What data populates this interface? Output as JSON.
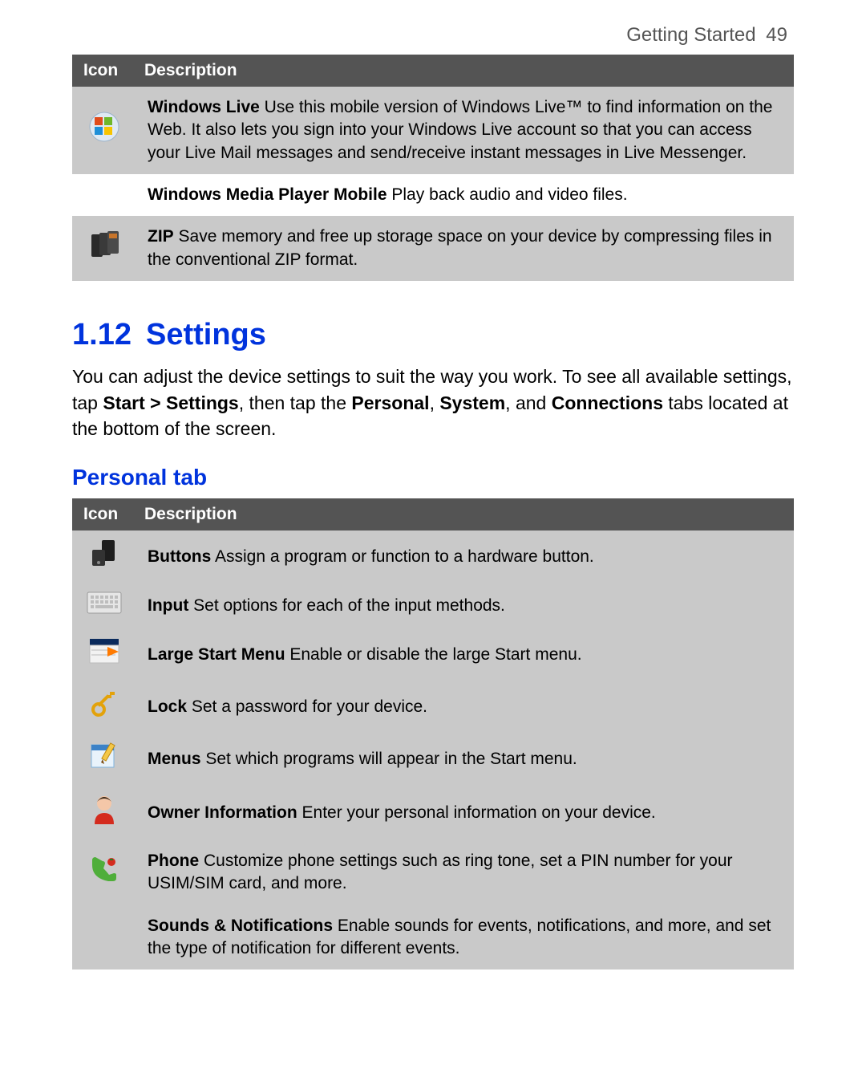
{
  "header": {
    "section": "Getting Started",
    "page": "49"
  },
  "table1": {
    "col_icon": "Icon",
    "col_desc": "Description",
    "rows": [
      {
        "bold": "Windows Live",
        "text": "  Use this mobile version of Windows Live™ to find information on the Web. It also lets you sign into your Windows Live account so that you can access your Live Mail messages and send/receive instant messages in Live Messenger."
      },
      {
        "bold": "Windows Media Player Mobile",
        "text": "  Play back audio and video files."
      },
      {
        "bold": "ZIP",
        "text": "  Save memory and free up storage space on your device by compressing files in the conventional ZIP format."
      }
    ]
  },
  "section": {
    "num": "1.12",
    "title": "Settings",
    "para_parts": {
      "p0": "You can adjust the device settings to suit the way you work. To see all available settings, tap ",
      "b0": "Start > Settings",
      "p1": ", then tap the ",
      "b1": "Personal",
      "p2": ", ",
      "b2": "System",
      "p3": ", and ",
      "b3": "Connections",
      "p4": " tabs located at the bottom of the screen."
    }
  },
  "subheading": "Personal tab",
  "table2": {
    "col_icon": "Icon",
    "col_desc": "Description",
    "rows": [
      {
        "bold": "Buttons",
        "text": "  Assign a program or function to a hardware button."
      },
      {
        "bold": "Input",
        "text": "  Set options for each of the input methods."
      },
      {
        "bold": "Large Start Menu",
        "text": "  Enable or disable the large Start menu."
      },
      {
        "bold": "Lock",
        "text": "  Set a password for your device."
      },
      {
        "bold": "Menus",
        "text": "  Set which programs will appear in the Start menu."
      },
      {
        "bold": "Owner Information",
        "text": "  Enter your personal information on your device."
      },
      {
        "bold": "Phone",
        "text": "  Customize phone settings such as ring tone, set a PIN number for your USIM/SIM card, and more."
      },
      {
        "bold": "Sounds & Notifications",
        "text": "  Enable sounds for events, notifications, and more, and set the type of notification for different events."
      }
    ]
  }
}
